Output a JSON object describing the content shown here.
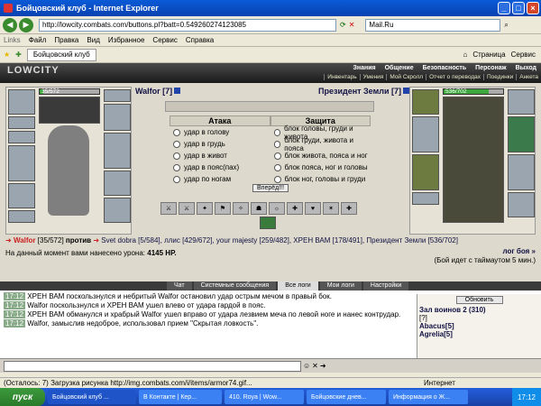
{
  "window": {
    "title": "Бойцовский клуб - Internet Explorer",
    "url": "http://lowcity.combats.com/buttons.pl?batt=0.549260274123085",
    "search_value": "Mail.Ru"
  },
  "menu": [
    "Файл",
    "Правка",
    "Вид",
    "Избранное",
    "Сервис",
    "Справка"
  ],
  "links_label": "Links",
  "tab_label": "Бойцовский клуб",
  "page_menu": [
    "Страница",
    "Сервис"
  ],
  "game": {
    "logo": "LOWCITY",
    "top_links": [
      "Знания",
      "Общение",
      "Безопасность",
      "Персонаж",
      "Выход"
    ],
    "sub_links": [
      "Инвентарь",
      "Умения",
      "Мой Скролл",
      "Отчет о переводах",
      "Поединки",
      "Анкета"
    ],
    "player_left": {
      "name": "Walfor [7]",
      "hp": "35/572",
      "hp_frac": 0.06
    },
    "player_right": {
      "name": "Президент Земли [7]",
      "hp": "536/702",
      "hp_frac": 0.76
    },
    "attack_header": "Атака",
    "defense_header": "Защита",
    "attacks": [
      "удар в голову",
      "удар в грудь",
      "удар в живот",
      "удар в пояс(пах)",
      "удар по ногам"
    ],
    "defenses": [
      "блок головы, груди и живота",
      "блок груди, живота и пояса",
      "блок живота, пояса и ног",
      "блок пояса, ног и головы",
      "блок ног, головы и груди"
    ],
    "forward_button": "Вперёд!!!",
    "combat_line": {
      "walfor": "Walfor",
      "walfor_hp": "[35/572]",
      "vs": "против",
      "enemies": "Svet dobra [5/584], ллис [429/672], your majesty [259/482], ХРЕН ВАМ [178/491], Президент Земли [536/702]",
      "next": "лог боя »"
    },
    "damage_label": "На данный момент вами нанесено урона:",
    "damage_value": "4145 HP.",
    "timeout": "(Бой идет с таймаутом 5 мин.)"
  },
  "chat": {
    "tabs": [
      "Чат",
      "Системные сообщения",
      "Все логи",
      "Мои логи",
      "Настройки"
    ],
    "messages": [
      {
        "time": "17:12",
        "text": "ХРЕН ВАМ поскользнулся и небритый Walfor остановил удар острым мечом в правый бок."
      },
      {
        "time": "17:12",
        "text": "Walfor поскользнулся и ХРЕН ВАМ ушел влево от удара гардой в пояс."
      },
      {
        "time": "17:12",
        "text": "ХРЕН ВАМ обманулся и храбрый Walfor ушел вправо от удара лезвием меча по левой ноге и нанес контрудар."
      },
      {
        "time": "17:12",
        "text": "Walfor, замыслив недоброе, использовал прием \"Скрытая ловкость\"."
      }
    ],
    "refresh_button": "Обновить",
    "room": "Зал воинов 2 (310)",
    "users": [
      "[?]",
      "Abacus[5]",
      "Agrelia[5]"
    ]
  },
  "statusbar": {
    "text": "(Осталось: 7) Загрузка рисунка http://img.combats.com/i/items/armor74.gif...",
    "zone": "Интернет"
  },
  "taskbar": {
    "start": "пуск",
    "tasks": [
      "Бойцовский клуб ...",
      "В Контакте | Кер...",
      "410. Roya | Wow...",
      "Бойцовские днев...",
      "Информация о Ж..."
    ],
    "time": "17:12"
  },
  "colors": {
    "accent": "#c22222",
    "hp": "#3ea83e",
    "title": "#0a5ad7"
  }
}
